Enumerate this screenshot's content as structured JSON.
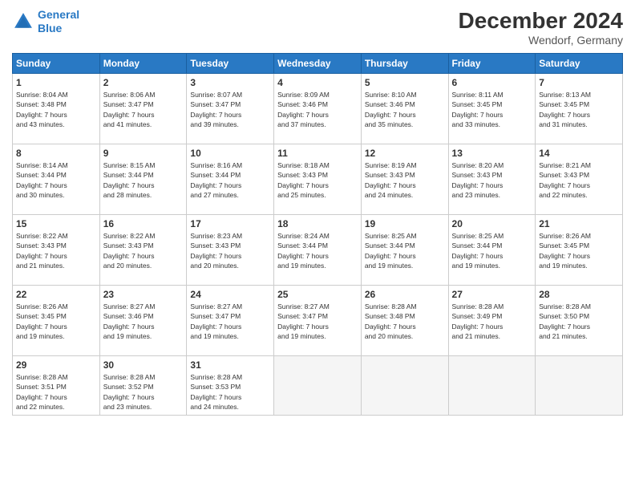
{
  "header": {
    "logo_line1": "General",
    "logo_line2": "Blue",
    "month": "December 2024",
    "location": "Wendorf, Germany"
  },
  "weekdays": [
    "Sunday",
    "Monday",
    "Tuesday",
    "Wednesday",
    "Thursday",
    "Friday",
    "Saturday"
  ],
  "weeks": [
    [
      {
        "day": "1",
        "info": "Sunrise: 8:04 AM\nSunset: 3:48 PM\nDaylight: 7 hours\nand 43 minutes."
      },
      {
        "day": "2",
        "info": "Sunrise: 8:06 AM\nSunset: 3:47 PM\nDaylight: 7 hours\nand 41 minutes."
      },
      {
        "day": "3",
        "info": "Sunrise: 8:07 AM\nSunset: 3:47 PM\nDaylight: 7 hours\nand 39 minutes."
      },
      {
        "day": "4",
        "info": "Sunrise: 8:09 AM\nSunset: 3:46 PM\nDaylight: 7 hours\nand 37 minutes."
      },
      {
        "day": "5",
        "info": "Sunrise: 8:10 AM\nSunset: 3:46 PM\nDaylight: 7 hours\nand 35 minutes."
      },
      {
        "day": "6",
        "info": "Sunrise: 8:11 AM\nSunset: 3:45 PM\nDaylight: 7 hours\nand 33 minutes."
      },
      {
        "day": "7",
        "info": "Sunrise: 8:13 AM\nSunset: 3:45 PM\nDaylight: 7 hours\nand 31 minutes."
      }
    ],
    [
      {
        "day": "8",
        "info": "Sunrise: 8:14 AM\nSunset: 3:44 PM\nDaylight: 7 hours\nand 30 minutes."
      },
      {
        "day": "9",
        "info": "Sunrise: 8:15 AM\nSunset: 3:44 PM\nDaylight: 7 hours\nand 28 minutes."
      },
      {
        "day": "10",
        "info": "Sunrise: 8:16 AM\nSunset: 3:44 PM\nDaylight: 7 hours\nand 27 minutes."
      },
      {
        "day": "11",
        "info": "Sunrise: 8:18 AM\nSunset: 3:43 PM\nDaylight: 7 hours\nand 25 minutes."
      },
      {
        "day": "12",
        "info": "Sunrise: 8:19 AM\nSunset: 3:43 PM\nDaylight: 7 hours\nand 24 minutes."
      },
      {
        "day": "13",
        "info": "Sunrise: 8:20 AM\nSunset: 3:43 PM\nDaylight: 7 hours\nand 23 minutes."
      },
      {
        "day": "14",
        "info": "Sunrise: 8:21 AM\nSunset: 3:43 PM\nDaylight: 7 hours\nand 22 minutes."
      }
    ],
    [
      {
        "day": "15",
        "info": "Sunrise: 8:22 AM\nSunset: 3:43 PM\nDaylight: 7 hours\nand 21 minutes."
      },
      {
        "day": "16",
        "info": "Sunrise: 8:22 AM\nSunset: 3:43 PM\nDaylight: 7 hours\nand 20 minutes."
      },
      {
        "day": "17",
        "info": "Sunrise: 8:23 AM\nSunset: 3:43 PM\nDaylight: 7 hours\nand 20 minutes."
      },
      {
        "day": "18",
        "info": "Sunrise: 8:24 AM\nSunset: 3:44 PM\nDaylight: 7 hours\nand 19 minutes."
      },
      {
        "day": "19",
        "info": "Sunrise: 8:25 AM\nSunset: 3:44 PM\nDaylight: 7 hours\nand 19 minutes."
      },
      {
        "day": "20",
        "info": "Sunrise: 8:25 AM\nSunset: 3:44 PM\nDaylight: 7 hours\nand 19 minutes."
      },
      {
        "day": "21",
        "info": "Sunrise: 8:26 AM\nSunset: 3:45 PM\nDaylight: 7 hours\nand 19 minutes."
      }
    ],
    [
      {
        "day": "22",
        "info": "Sunrise: 8:26 AM\nSunset: 3:45 PM\nDaylight: 7 hours\nand 19 minutes."
      },
      {
        "day": "23",
        "info": "Sunrise: 8:27 AM\nSunset: 3:46 PM\nDaylight: 7 hours\nand 19 minutes."
      },
      {
        "day": "24",
        "info": "Sunrise: 8:27 AM\nSunset: 3:47 PM\nDaylight: 7 hours\nand 19 minutes."
      },
      {
        "day": "25",
        "info": "Sunrise: 8:27 AM\nSunset: 3:47 PM\nDaylight: 7 hours\nand 19 minutes."
      },
      {
        "day": "26",
        "info": "Sunrise: 8:28 AM\nSunset: 3:48 PM\nDaylight: 7 hours\nand 20 minutes."
      },
      {
        "day": "27",
        "info": "Sunrise: 8:28 AM\nSunset: 3:49 PM\nDaylight: 7 hours\nand 21 minutes."
      },
      {
        "day": "28",
        "info": "Sunrise: 8:28 AM\nSunset: 3:50 PM\nDaylight: 7 hours\nand 21 minutes."
      }
    ],
    [
      {
        "day": "29",
        "info": "Sunrise: 8:28 AM\nSunset: 3:51 PM\nDaylight: 7 hours\nand 22 minutes."
      },
      {
        "day": "30",
        "info": "Sunrise: 8:28 AM\nSunset: 3:52 PM\nDaylight: 7 hours\nand 23 minutes."
      },
      {
        "day": "31",
        "info": "Sunrise: 8:28 AM\nSunset: 3:53 PM\nDaylight: 7 hours\nand 24 minutes."
      },
      {
        "day": "",
        "info": ""
      },
      {
        "day": "",
        "info": ""
      },
      {
        "day": "",
        "info": ""
      },
      {
        "day": "",
        "info": ""
      }
    ]
  ]
}
